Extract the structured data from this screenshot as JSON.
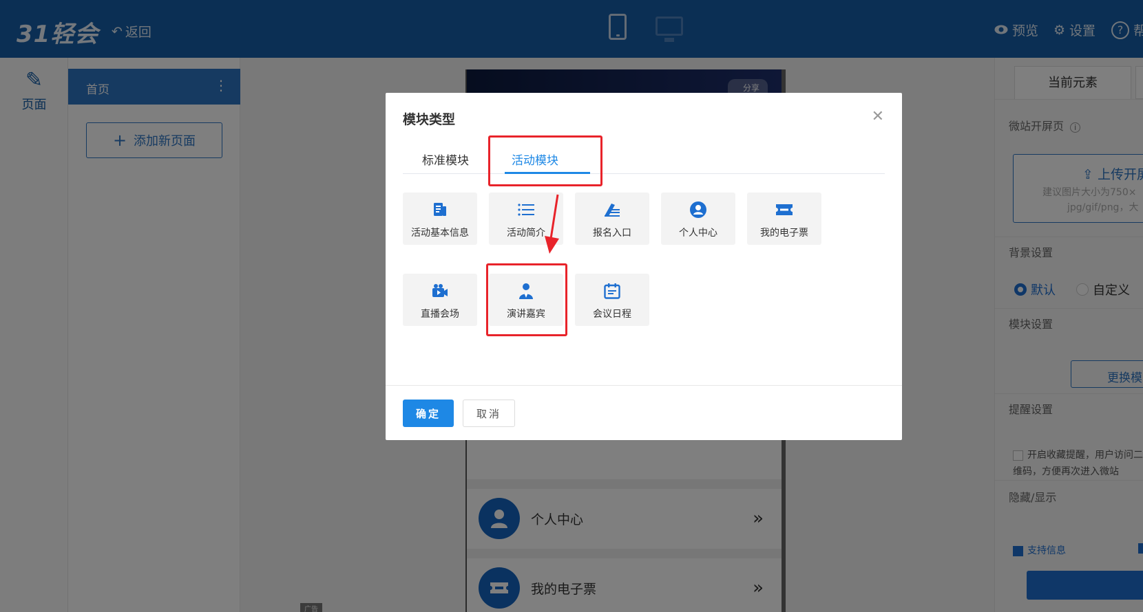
{
  "topbar": {
    "logo": "31轻会",
    "back_label": "返回",
    "preview_label": "预览",
    "settings_label": "设置",
    "help_label": "帮"
  },
  "rail": {
    "pages_label": "页面"
  },
  "pages_panel": {
    "current_page": "首页",
    "add_page_label": "添加新页面"
  },
  "canvas": {
    "share_label": "分享",
    "modules": [
      {
        "label": "个人中心",
        "icon": "user-icon"
      },
      {
        "label": "我的电子票",
        "icon": "ticket-icon"
      }
    ],
    "ad_tag": "广告"
  },
  "right_panel": {
    "tab_current": "当前元素",
    "splash_label": "微站开屏页",
    "upload_label": "上传开屏",
    "upload_hint_1": "建议图片大小为750×",
    "upload_hint_2": "jpg/gif/png，大",
    "bg_label": "背景设置",
    "bg_default": "默认",
    "bg_custom": "自定义",
    "module_label": "模块设置",
    "change_btn": "更换模",
    "remind_label": "提醒设置",
    "remind_text": "开启收藏提醒，用户访问二维码，方便再次进入微站",
    "visibility_label": "隐藏/显示",
    "support_label": "支持信息"
  },
  "modal": {
    "title": "模块类型",
    "tabs": [
      {
        "label": "标准模块"
      },
      {
        "label": "活动模块"
      }
    ],
    "items": [
      {
        "label": "活动基本信息",
        "icon": "info-doc-icon"
      },
      {
        "label": "活动简介",
        "icon": "list-icon"
      },
      {
        "label": "报名入口",
        "icon": "signup-pen-icon"
      },
      {
        "label": "个人中心",
        "icon": "user-circle-icon"
      },
      {
        "label": "我的电子票",
        "icon": "ticket-icon"
      },
      {
        "label": "直播会场",
        "icon": "video-camera-icon"
      },
      {
        "label": "演讲嘉宾",
        "icon": "speaker-icon"
      },
      {
        "label": "会议日程",
        "icon": "calendar-icon"
      }
    ],
    "ok_label": "确定",
    "cancel_label": "取消"
  },
  "colors": {
    "topbar": "#175fa8",
    "accent": "#1e88e5",
    "annotation": "#e8232a"
  }
}
